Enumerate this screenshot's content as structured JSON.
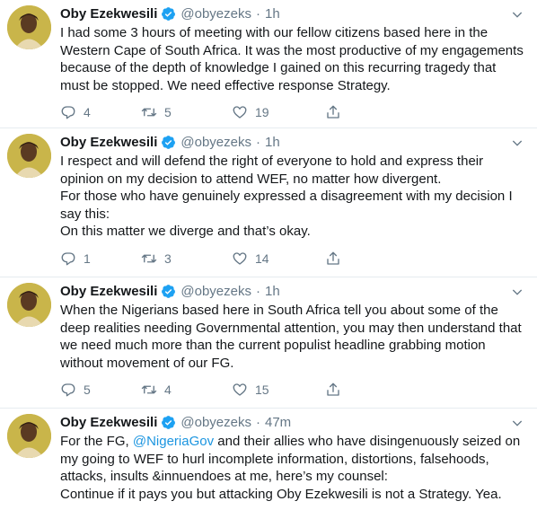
{
  "colors": {
    "text": "#14171a",
    "muted": "#657786",
    "link": "#1b95e0",
    "verified": "#1da1f2",
    "divider": "#e6ecf0"
  },
  "icons": {
    "reply": "reply-icon",
    "retweet": "retweet-icon",
    "like": "heart-icon",
    "share": "share-icon",
    "verified": "verified-badge-icon",
    "caret": "chevron-down-icon"
  },
  "tweets": [
    {
      "name": "Oby Ezekwesili",
      "handle": "@obyezeks",
      "dot": "·",
      "time": "1h",
      "text": [
        "I had some 3 hours of meeting with our fellow citizens based here in the Western Cape of South Africa. It was the most productive of my engagements because of the depth of knowledge I gained on this recurring tragedy that must be stopped. We need effective response Strategy."
      ],
      "replies": "4",
      "retweets": "5",
      "likes": "19"
    },
    {
      "name": "Oby Ezekwesili",
      "handle": "@obyezeks",
      "dot": "·",
      "time": "1h",
      "text": [
        "I respect and will defend the right of everyone to hold and express their opinion on my decision to attend WEF, no matter how divergent.",
        "For those who have genuinely expressed a disagreement with my decision I say this:",
        "On this matter we diverge and that’s okay."
      ],
      "replies": "1",
      "retweets": "3",
      "likes": "14"
    },
    {
      "name": "Oby Ezekwesili",
      "handle": "@obyezeks",
      "dot": "·",
      "time": "1h",
      "text": [
        "When the Nigerians based here in South Africa tell you about some of the deep realities needing Governmental attention, you may then understand that we need much more than the current populist headline grabbing motion without movement of our FG."
      ],
      "replies": "5",
      "retweets": "4",
      "likes": "15"
    },
    {
      "name": "Oby Ezekwesili",
      "handle": "@obyezeks",
      "dot": "·",
      "time": "47m",
      "text_prefix": "For the FG, ",
      "mention": "@NigeriaGov",
      "text_suffix": " and their allies who have disingenuously seized on my going to WEF to hurl incomplete information, distortions, falsehoods, attacks, insults &innuendoes at me, here’s my counsel:",
      "text_last": "Continue if it pays you but attacking Oby Ezekwesili is not a Strategy. Yea."
    }
  ]
}
